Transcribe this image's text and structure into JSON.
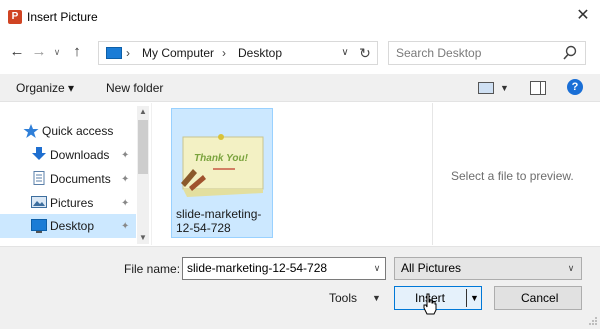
{
  "window": {
    "title": "Insert Picture",
    "app_icon_letter": "P",
    "close_glyph": "✕"
  },
  "address": {
    "back_glyph": "←",
    "forward_glyph": "→",
    "recent_glyph": "∨",
    "up_glyph": "↑",
    "separator": "›",
    "crumbs": [
      "My Computer",
      "Desktop"
    ],
    "dropdown_glyph": "∨",
    "refresh_glyph": "↻"
  },
  "search": {
    "placeholder": "Search Desktop",
    "icon": "search-icon"
  },
  "toolbar": {
    "organize_label": "Organize ▾",
    "new_folder_label": "New folder",
    "view_arrow": "▼",
    "help_glyph": "?"
  },
  "nav": {
    "scroll_up": "▲",
    "scroll_down": "▼",
    "pin_glyph": "✦",
    "items": [
      {
        "label": "Quick access",
        "icon": "star-icon"
      },
      {
        "label": "Downloads",
        "icon": "download-icon",
        "pinned": true
      },
      {
        "label": "Documents",
        "icon": "document-icon",
        "pinned": true
      },
      {
        "label": "Pictures",
        "icon": "pictures-icon",
        "pinned": true
      },
      {
        "label": "Desktop",
        "icon": "desktop-icon",
        "pinned": true,
        "selected": true
      }
    ]
  },
  "files": [
    {
      "name": "slide-marketing-12-54-728",
      "thumbnail_text": "Thank You!",
      "selected": true
    }
  ],
  "preview": {
    "message": "Select a file to preview."
  },
  "bottom": {
    "file_name_label": "File name:",
    "file_name_value": "slide-marketing-12-54-728",
    "file_type_value": "All Pictures",
    "tools_label": "Tools",
    "insert_label": "Insert",
    "cancel_label": "Cancel",
    "dropdown_glyph": "∨",
    "arrow_glyph": "▼"
  },
  "colors": {
    "accent": "#0078d7",
    "selection": "#cce8ff",
    "app_icon": "#d04423"
  }
}
